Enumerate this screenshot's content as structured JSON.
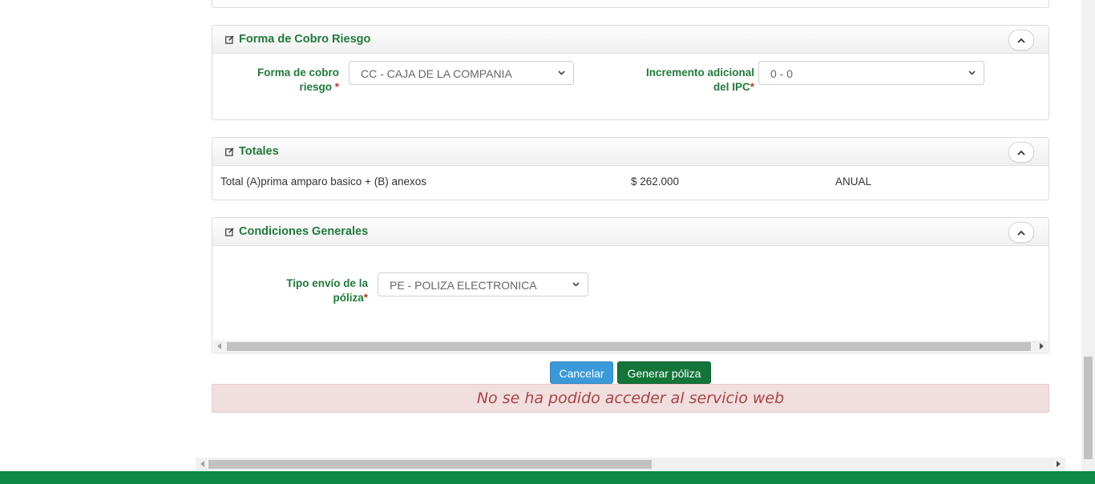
{
  "forma_cobro": {
    "title": "Forma de Cobro Riesgo",
    "field1_label_l1": "Forma de cobro",
    "field1_label_l2": "riesgo",
    "field1_value": "CC - CAJA DE LA COMPANIA",
    "field2_label_l1": "Incremento adicional",
    "field2_label_l2": "del IPC",
    "field2_value": "0 - 0",
    "required_mark": "*"
  },
  "totales": {
    "title": "Totales",
    "row_label": "Total (A)prima amparo basico + (B) anexos",
    "row_amount": "$ 262.000",
    "row_period": "ANUAL"
  },
  "condiciones": {
    "title": "Condiciones Generales",
    "field_label_l1": "Tipo envío de la",
    "field_label_l2": "póliza",
    "field_value": "PE - POLIZA ELECTRONICA",
    "required_mark": "*"
  },
  "actions": {
    "cancel_label": "Cancelar",
    "generate_label": "Generar póliza"
  },
  "alert": {
    "message": "No se ha podido acceder al servicio web"
  },
  "colors": {
    "accent_green": "#1f7a3a",
    "footer_green": "#0f8a45",
    "cancel_blue": "#3a9ad9",
    "alert_bg": "#f1dede",
    "alert_text": "#a94442"
  },
  "icons": {
    "panel_icon": "edit-icon",
    "collapse_icon": "chevron-up-icon",
    "select_icon": "chevron-down-icon"
  }
}
